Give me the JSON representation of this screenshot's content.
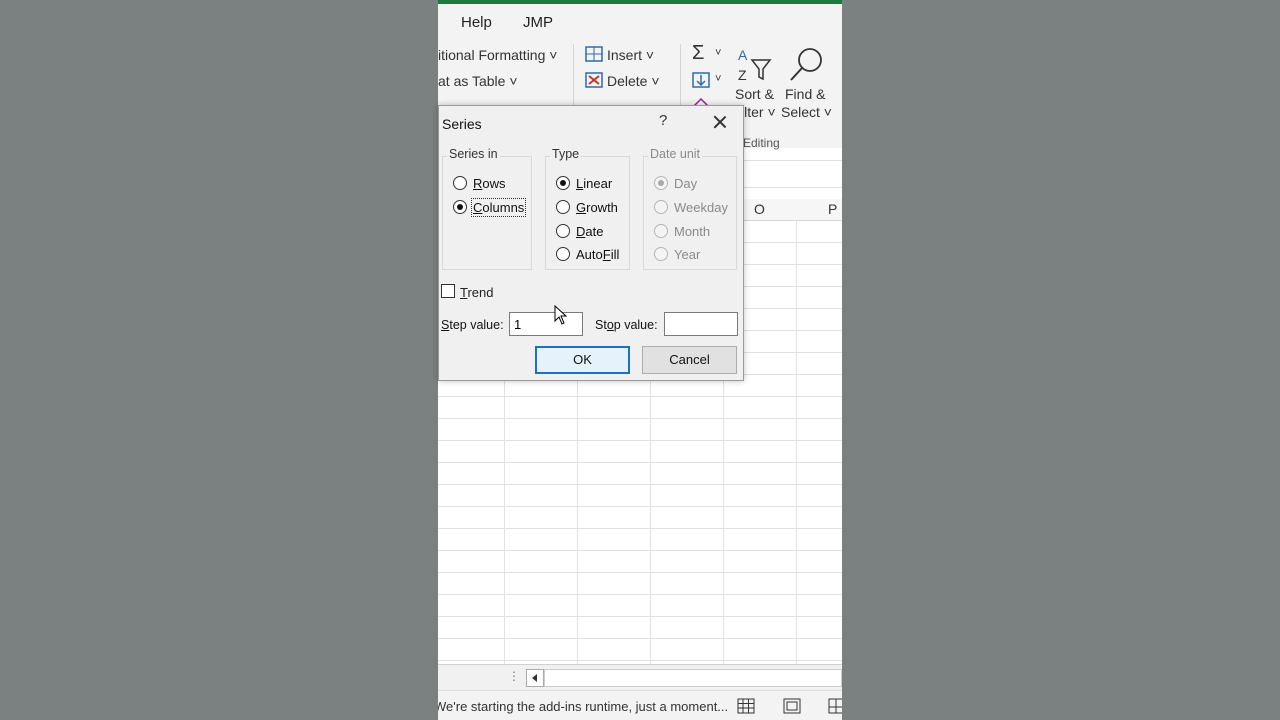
{
  "ribbon": {
    "tabs": [
      "Help",
      "JMP"
    ],
    "conditional_formatting": "itional Formatting",
    "format_as_table": "at as Table",
    "insert_label": "Insert",
    "delete_label": "Delete",
    "sort_filter": [
      "Sort &",
      "ilter"
    ],
    "find_select": [
      "Find &",
      "Select"
    ],
    "editing_group": "Editing"
  },
  "sheet": {
    "column_headers": [
      "O",
      "P"
    ]
  },
  "status": {
    "message": "We're starting the add-ins runtime, just a moment..."
  },
  "dialog": {
    "title": "Series",
    "help": "?",
    "series_in": {
      "legend": "Series in",
      "options": [
        {
          "label": "Rows",
          "checked": false
        },
        {
          "label": "Columns",
          "checked": true
        }
      ]
    },
    "type": {
      "legend": "Type",
      "options": [
        {
          "label": "Linear",
          "checked": true
        },
        {
          "label": "Growth",
          "checked": false
        },
        {
          "label": "Date",
          "checked": false
        },
        {
          "label": "AutoFill",
          "checked": false
        }
      ]
    },
    "date_unit": {
      "legend": "Date unit",
      "options": [
        {
          "label": "Day",
          "checked": true
        },
        {
          "label": "Weekday",
          "checked": false
        },
        {
          "label": "Month",
          "checked": false
        },
        {
          "label": "Year",
          "checked": false
        }
      ]
    },
    "trend_label": "Trend",
    "step_value_label": "Step value:",
    "step_value": "1",
    "stop_value_label": "Stop value:",
    "stop_value": "",
    "ok_label": "OK",
    "cancel_label": "Cancel"
  },
  "colors": {
    "excel_green": "#1e7a3c",
    "default_button_border": "#1a73c0",
    "backdrop": "#7b8181"
  }
}
